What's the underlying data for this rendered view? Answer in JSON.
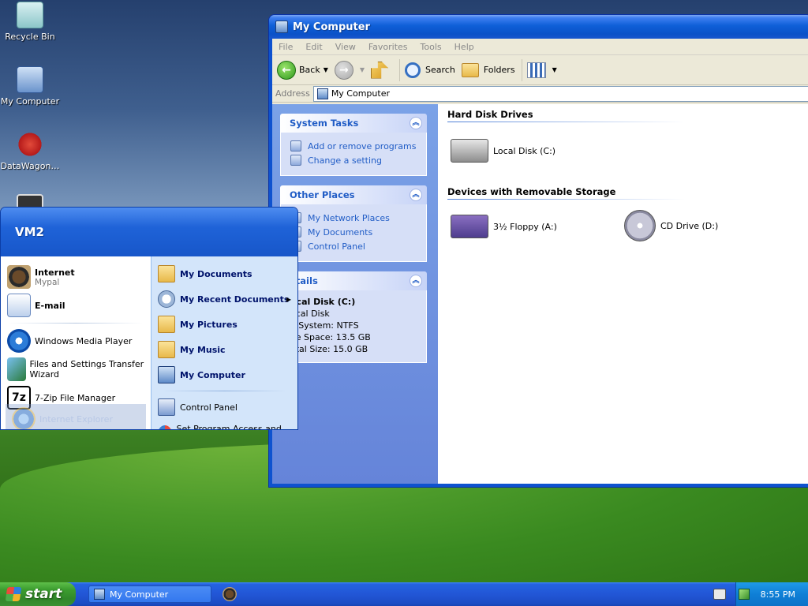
{
  "desktop": {
    "icons": [
      {
        "label": "Recycle Bin"
      },
      {
        "label": "My Computer"
      },
      {
        "label": "DataWagon…"
      }
    ]
  },
  "window": {
    "title": "My Computer",
    "menu": [
      "File",
      "Edit",
      "View",
      "Favorites",
      "Tools",
      "Help"
    ],
    "toolbar": {
      "back": "Back",
      "search": "Search",
      "folders": "Folders"
    },
    "address": {
      "label": "Address",
      "value": "My Computer"
    },
    "taskpane": {
      "system_tasks": {
        "title": "System Tasks",
        "links": [
          "Add or remove programs",
          "Change a setting"
        ]
      },
      "other_places": {
        "title": "Other Places",
        "links": [
          "My Network Places",
          "My Documents",
          "Control Panel"
        ]
      },
      "details": {
        "title": "etails",
        "name": "ocal Disk (C:)",
        "type": "ocal Disk",
        "fs": "e System: NTFS",
        "free": "ee Space: 13.5 GB",
        "total": "otal Size: 15.0 GB"
      }
    },
    "groups": {
      "hard_disks": {
        "title": "Hard Disk Drives",
        "items": [
          "Local Disk (C:)"
        ]
      },
      "removable": {
        "title": "Devices with Removable Storage",
        "items": [
          "3½ Floppy (A:)",
          "CD Drive (D:)"
        ]
      }
    }
  },
  "startmenu": {
    "user": "VM2",
    "left": {
      "pinned": [
        {
          "title": "Internet",
          "subtitle": "Mypal"
        },
        {
          "title": "E-mail"
        }
      ],
      "recent": [
        "Windows Media Player",
        "Files and Settings Transfer Wizard",
        "7-Zip File Manager"
      ],
      "ghost": "Internet Explorer"
    },
    "right": {
      "places": [
        "My Documents",
        "My Recent Documents",
        "My Pictures",
        "My Music",
        "My Computer"
      ],
      "system": [
        "Control Panel",
        "Set Program Access and Defaults"
      ]
    },
    "zip_glyph": "7z"
  },
  "taskbar": {
    "start": "start",
    "task": "My Computer",
    "clock": "8:55 PM"
  }
}
